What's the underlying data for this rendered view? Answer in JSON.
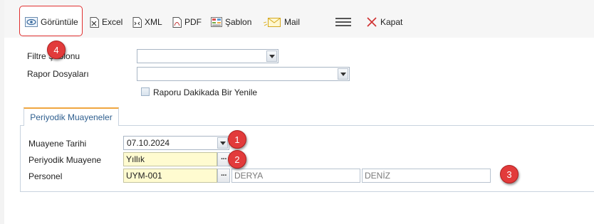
{
  "toolbar": {
    "items": [
      {
        "label": "Görüntüle",
        "icon": "view-icon"
      },
      {
        "label": "Excel",
        "icon": "excel-icon"
      },
      {
        "label": "XML",
        "icon": "xml-icon"
      },
      {
        "label": "PDF",
        "icon": "pdf-icon"
      },
      {
        "label": "Şablon",
        "icon": "template-icon"
      },
      {
        "label": "Mail",
        "icon": "mail-icon"
      },
      {
        "label": "",
        "icon": "hamburger-menu-icon"
      },
      {
        "label": "Kapat",
        "icon": "close-icon"
      }
    ]
  },
  "filters": {
    "template_label": "Filtre Şablonu",
    "template_value": "",
    "report_files_label": "Rapor Dosyaları",
    "report_files_value": "",
    "refresh_label": "Raporu Dakikada Bir Yenile",
    "refresh_checked": false
  },
  "tab": {
    "label": "Periyodik Muayeneler"
  },
  "form": {
    "date_label": "Muayene Tarihi",
    "date_value": "07.10.2024",
    "inspection_label": "Periyodik Muayene",
    "inspection_value": "Yıllık",
    "personnel_label": "Personel",
    "personnel_code": "UYM-001",
    "personnel_first_name": "DERYA",
    "personnel_last_name": "DENİZ"
  },
  "badges": [
    "4",
    "1",
    "2",
    "3"
  ],
  "colors": {
    "badge": "#e23b3b",
    "highlight_border": "#e03030",
    "tab_accent": "#f0a640",
    "required_field": "#fffbd0"
  }
}
